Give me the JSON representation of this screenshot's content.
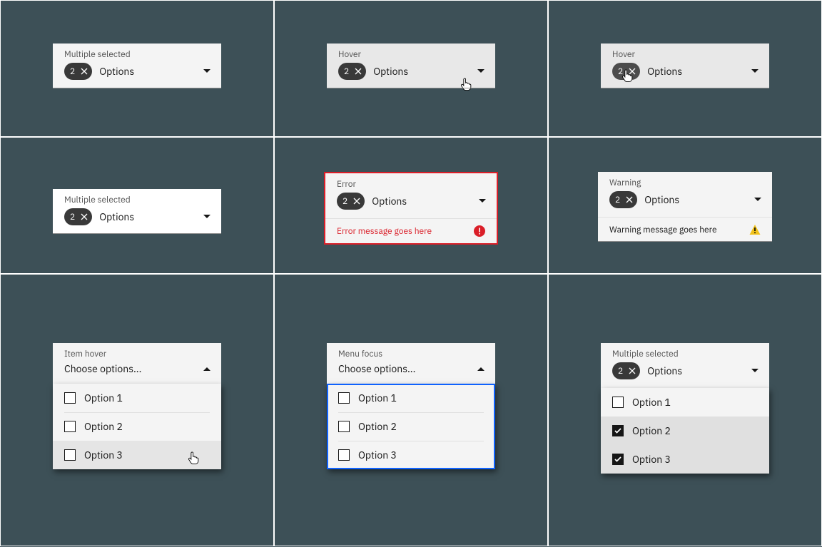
{
  "cells": {
    "r1c1": {
      "label": "Multiple selected",
      "count": "2",
      "text": "Options"
    },
    "r1c2": {
      "label": "Hover",
      "count": "2",
      "text": "Options"
    },
    "r1c3": {
      "label": "Hover",
      "count": "2",
      "text": "Options"
    },
    "r2c1": {
      "label": "Multiple selected",
      "count": "2",
      "text": "Options"
    },
    "r2c2": {
      "label": "Error",
      "count": "2",
      "text": "Options",
      "helper": "Error message goes here"
    },
    "r2c3": {
      "label": "Warning",
      "count": "2",
      "text": "Options",
      "helper": "Warning message goes here"
    },
    "r3c1": {
      "label": "Item hover",
      "text": "Choose options...",
      "options": [
        "Option 1",
        "Option 2",
        "Option 3"
      ]
    },
    "r3c2": {
      "label": "Menu focus",
      "text": "Choose options...",
      "options": [
        "Option 1",
        "Option 2",
        "Option 3"
      ]
    },
    "r3c3": {
      "label": "Multiple selected",
      "count": "2",
      "text": "Options",
      "options": [
        "Option 1",
        "Option 2",
        "Option 3"
      ]
    }
  }
}
